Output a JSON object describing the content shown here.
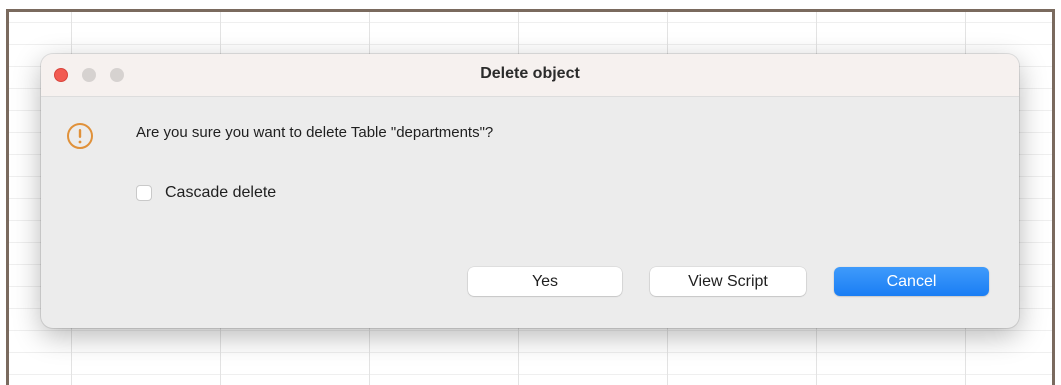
{
  "dialog": {
    "title": "Delete object",
    "message": "Are you sure you want to delete Table \"departments\"?",
    "icon": "warning-icon",
    "cascade_checkbox": {
      "label": "Cascade delete",
      "checked": false
    },
    "buttons": {
      "yes_label": "Yes",
      "view_script_label": "View Script",
      "cancel_label": "Cancel"
    }
  },
  "colors": {
    "accent": "#1a7ef4",
    "warning": "#e0913a",
    "close_button": "#f25b52"
  }
}
